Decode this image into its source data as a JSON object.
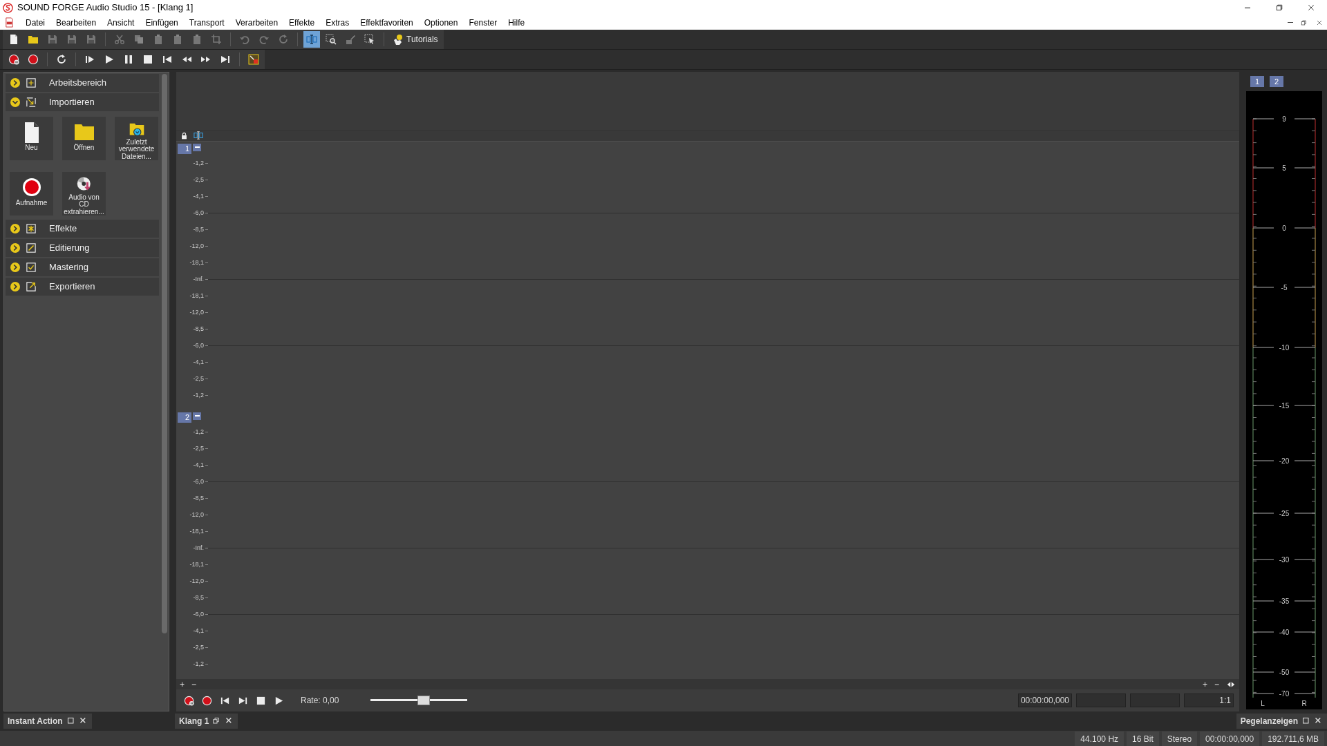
{
  "window": {
    "title": "SOUND FORGE Audio Studio 15 - [Klang 1]"
  },
  "menu": [
    "Datei",
    "Bearbeiten",
    "Ansicht",
    "Einfügen",
    "Transport",
    "Verarbeiten",
    "Effekte",
    "Extras",
    "Effektfavoriten",
    "Optionen",
    "Fenster",
    "Hilfe"
  ],
  "toolbar": [
    {
      "kind": "new",
      "disabled": false,
      "selected": false
    },
    {
      "kind": "open",
      "disabled": false,
      "selected": false
    },
    {
      "kind": "save",
      "disabled": true,
      "selected": false
    },
    {
      "kind": "save",
      "disabled": true,
      "selected": false
    },
    {
      "kind": "save",
      "disabled": true,
      "selected": false
    },
    {
      "kind": "sep"
    },
    {
      "kind": "cut",
      "disabled": true,
      "selected": false
    },
    {
      "kind": "copy",
      "disabled": true,
      "selected": false
    },
    {
      "kind": "paste",
      "disabled": true,
      "selected": false
    },
    {
      "kind": "paste",
      "disabled": true,
      "selected": false
    },
    {
      "kind": "paste",
      "disabled": true,
      "selected": false
    },
    {
      "kind": "crop",
      "disabled": true,
      "selected": false
    },
    {
      "kind": "sep"
    },
    {
      "kind": "undo",
      "disabled": true,
      "selected": false
    },
    {
      "kind": "redo",
      "disabled": true,
      "selected": false
    },
    {
      "kind": "repeat",
      "disabled": true,
      "selected": false
    },
    {
      "kind": "sep"
    },
    {
      "kind": "edit",
      "disabled": false,
      "selected": true
    },
    {
      "kind": "magnify",
      "disabled": false,
      "selected": false
    },
    {
      "kind": "pencil",
      "disabled": true,
      "selected": false
    },
    {
      "kind": "select",
      "disabled": false,
      "selected": false
    },
    {
      "kind": "sep"
    },
    {
      "kind": "tutorials",
      "label": "Tutorials"
    }
  ],
  "transport": [
    {
      "kind": "rec-pause"
    },
    {
      "kind": "record"
    },
    {
      "kind": "sep"
    },
    {
      "kind": "loop"
    },
    {
      "kind": "sep"
    },
    {
      "kind": "play-all"
    },
    {
      "kind": "play"
    },
    {
      "kind": "pause"
    },
    {
      "kind": "stop"
    },
    {
      "kind": "start"
    },
    {
      "kind": "rewind"
    },
    {
      "kind": "forward"
    },
    {
      "kind": "end"
    },
    {
      "kind": "sep"
    },
    {
      "kind": "punch"
    }
  ],
  "explorer": {
    "sections": [
      {
        "label": "Arbeitsbereich",
        "kind": "workspace",
        "expanded": false
      },
      {
        "label": "Importieren",
        "kind": "import",
        "expanded": true,
        "items": [
          {
            "label": "Neu",
            "kind": "new"
          },
          {
            "label": "Öffnen",
            "kind": "open"
          },
          {
            "label": "Zuletzt verwendete Dateien...",
            "kind": "recent"
          },
          {
            "label": "Aufnahme",
            "kind": "record"
          },
          {
            "label": "Audio von CD extrahieren...",
            "kind": "cd"
          }
        ]
      },
      {
        "label": "Effekte",
        "kind": "effects",
        "expanded": false
      },
      {
        "label": "Editierung",
        "kind": "edit",
        "expanded": false
      },
      {
        "label": "Mastering",
        "kind": "mastering",
        "expanded": false
      },
      {
        "label": "Exportieren",
        "kind": "export",
        "expanded": false
      }
    ],
    "tab": "Instant Action"
  },
  "data_window": {
    "channels": [
      {
        "number": "1",
        "scale": [
          "-1,2",
          "-2,5",
          "-4,1",
          "-6,0",
          "-8,5",
          "-12,0",
          "-18,1",
          "-Inf.",
          "-18,1",
          "-12,0",
          "-8,5",
          "-6,0",
          "-4,1",
          "-2,5",
          "-1,2"
        ]
      },
      {
        "number": "2",
        "scale": [
          "-1,2",
          "-2,5",
          "-4,1",
          "-6,0",
          "-8,5",
          "-12,0",
          "-18,1",
          "-Inf.",
          "-18,1",
          "-12,0",
          "-8,5",
          "-6,0",
          "-4,1",
          "-2,5",
          "-1,2"
        ]
      }
    ],
    "zoom_left": [
      "+",
      "−"
    ],
    "zoom_right": [
      "+",
      "−"
    ],
    "transport": [
      {
        "kind": "rec-pause"
      },
      {
        "kind": "record"
      },
      {
        "kind": "start"
      },
      {
        "kind": "end"
      },
      {
        "kind": "stop"
      },
      {
        "kind": "play"
      }
    ],
    "rate": "Rate: 0,00",
    "rate_slider": {
      "level": 0.55
    },
    "time": "00:00:00,000",
    "zoom_ratio": "1:1",
    "tab": "Klang 1"
  },
  "meter": {
    "channels": [
      "1",
      "2"
    ],
    "scale": [
      "9",
      "5",
      "0",
      "-5",
      "-10",
      "-15",
      "-20",
      "-25",
      "-30",
      "-35",
      "-40",
      "-50",
      "-70"
    ],
    "sides": [
      "L",
      "R"
    ],
    "tab": "Pegelanzeigen"
  },
  "status_bar": [
    "44.100 Hz",
    "16 Bit",
    "Stereo",
    "00:00:00,000",
    "192.711,6 MB"
  ]
}
